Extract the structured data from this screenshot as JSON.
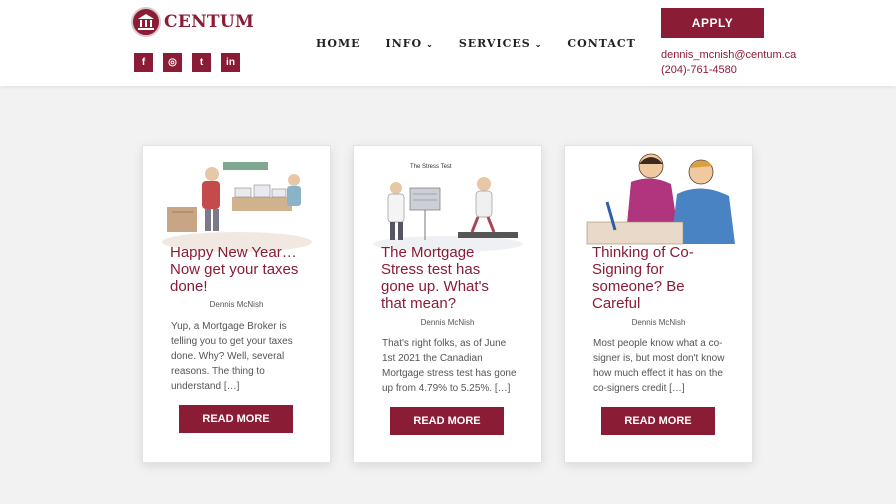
{
  "brand": {
    "name": "CENTUM",
    "color": "#8a1c35"
  },
  "socials": [
    {
      "label": "f",
      "icon": "facebook-icon"
    },
    {
      "label": "◎",
      "icon": "instagram-icon"
    },
    {
      "label": "t",
      "icon": "twitter-icon"
    },
    {
      "label": "in",
      "icon": "linkedin-icon"
    }
  ],
  "nav": {
    "home": "HOME",
    "info": "INFO",
    "services": "SERVICES",
    "contact": "CONTACT",
    "caret": "⌄"
  },
  "header": {
    "apply_label": "APPLY",
    "email": "dennis_mcnish@centum.ca",
    "phone": "(204)-761-4580"
  },
  "posts": [
    {
      "title_lines": [
        "Happy New Year…",
        "Now get your taxes",
        "done!"
      ],
      "author": "Dennis McNish",
      "excerpt_lines": [
        "Yup, a Mortgage Broker is",
        "telling you to get your taxes",
        "done.  Why?  Well, several",
        "reasons.  The thing to",
        "understand […]"
      ],
      "button": "READ MORE"
    },
    {
      "image_caption": "The Stress Test",
      "title_lines": [
        "The Mortgage",
        "Stress test has",
        "gone up. What's",
        "that mean?"
      ],
      "author": "Dennis McNish",
      "excerpt_lines": [
        "That's right folks, as of June",
        "1st 2021 the Canadian",
        "Mortgage stress test has gone",
        "up from 4.79% to 5.25%.  […]"
      ],
      "button": "READ MORE"
    },
    {
      "title_lines": [
        "Thinking of Co-",
        "Signing for",
        "someone? Be",
        "Careful"
      ],
      "author": "Dennis McNish",
      "excerpt_lines": [
        "Most people know what a co-",
        "signer is, but most don't know",
        "how much effect it has on the",
        "co-signers credit […]"
      ],
      "button": "READ MORE"
    }
  ]
}
